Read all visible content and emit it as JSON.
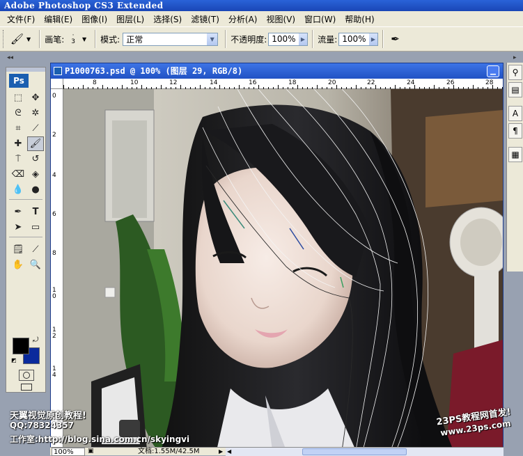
{
  "app": {
    "title": "Adobe Photoshop CS3 Extended"
  },
  "menu": [
    "文件(F)",
    "编辑(E)",
    "图像(I)",
    "图层(L)",
    "选择(S)",
    "滤镜(T)",
    "分析(A)",
    "视图(V)",
    "窗口(W)",
    "帮助(H)"
  ],
  "options": {
    "brush_label": "画笔:",
    "brush_size": "3",
    "mode_label": "模式:",
    "mode_value": "正常",
    "opacity_label": "不透明度:",
    "opacity_value": "100%",
    "flow_label": "流量:",
    "flow_value": "100%"
  },
  "toolbox": {
    "logo": "Ps"
  },
  "document": {
    "title": "P1000763.psd @ 100% (图层 29, RGB/8)",
    "ruler_top": [
      "8",
      "10",
      "12",
      "14",
      "16",
      "18",
      "20",
      "22",
      "24",
      "26",
      "28"
    ],
    "ruler_left": [
      "0",
      "2",
      "4",
      "6",
      "8",
      "10",
      "12",
      "14"
    ]
  },
  "status": {
    "zoom": "100%",
    "doc": "文档:1.55M/42.5M"
  },
  "watermark": {
    "line1": "天翼视觉原创教程!",
    "line2": "QQ:78324357",
    "line3": "工作室:http://blog.sina.com.cn/skyingvi",
    "brand1": "23PS教程网首发!",
    "brand2": "www.23ps.com"
  }
}
